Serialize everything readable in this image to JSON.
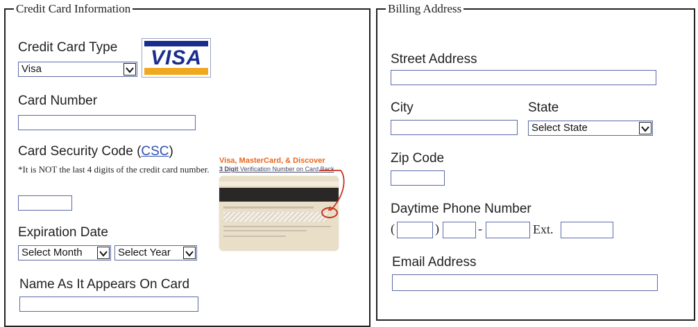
{
  "credit": {
    "title": "Credit Card Information",
    "card_type_label": "Credit Card Type",
    "card_type_value": "Visa",
    "visa_logo_text": "VISA",
    "card_number_label": "Card Number",
    "csc_label": "Card Security Code (",
    "csc_link": "CSC",
    "csc_close": ")",
    "csc_note": "*It is NOT the last 4 digits of the credit card number.",
    "card_back_title": "Visa, MasterCard, & Discover",
    "card_back_subtitle_bold": "3 Digit",
    "card_back_subtitle_rest": " Verification Number on Card Back",
    "expiration_label": "Expiration Date",
    "month_select": "Select Month",
    "year_select": "Select Year",
    "name_label": "Name As It Appears On Card"
  },
  "billing": {
    "title": "Billing Address",
    "street_label": "Street Address",
    "city_label": "City",
    "state_label": "State",
    "state_select": "Select State",
    "zip_label": "Zip Code",
    "phone_label": "Daytime Phone Number",
    "phone_open": "(",
    "phone_close": ")",
    "phone_dash": "-",
    "ext_label": "Ext.",
    "email_label": "Email Address"
  },
  "colors": {
    "visa_blue": "#1a2d8f",
    "visa_gold": "#f0a81f",
    "card_back_title": "#e8661e",
    "link": "#2f4fb0",
    "field_border": "#5b6aa6"
  }
}
